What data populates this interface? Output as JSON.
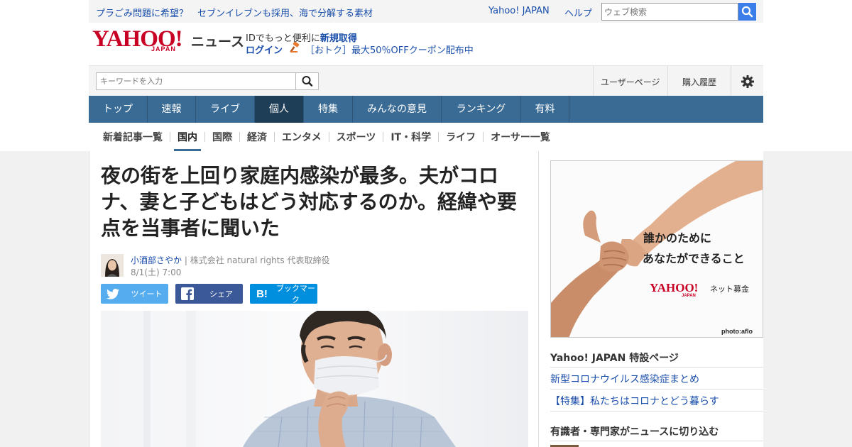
{
  "topbar": {
    "promo_1": "プラごみ問題に希望？",
    "promo_2": "セブンイレブンも採用、海で分解する素材",
    "yahoo_japan": "Yahoo! JAPAN",
    "help": "ヘルプ",
    "web_search_placeholder": "ウェブ検索"
  },
  "header": {
    "logo_yahoo": "YAHOO!",
    "logo_japan": "JAPAN",
    "logo_news": "ニュース",
    "id_text": "IDでもっと便利に",
    "signup": "新規取得",
    "login": "ログイン",
    "coupon": "［おトク］最大50％OFFクーポン配布中"
  },
  "search": {
    "placeholder": "キーワードを入力",
    "user_page": "ユーザーページ",
    "purchase_history": "購入履歴"
  },
  "main_nav": [
    {
      "label": "トップ",
      "active": false
    },
    {
      "label": "速報",
      "active": false
    },
    {
      "label": "ライブ",
      "active": false
    },
    {
      "label": "個人",
      "active": true
    },
    {
      "label": "特集",
      "active": false
    },
    {
      "label": "みんなの意見",
      "active": false
    },
    {
      "label": "ランキング",
      "active": false
    },
    {
      "label": "有料",
      "active": false
    }
  ],
  "sub_nav": [
    {
      "label": "新着記事一覧",
      "active": false
    },
    {
      "label": "国内",
      "active": true
    },
    {
      "label": "国際",
      "active": false
    },
    {
      "label": "経済",
      "active": false
    },
    {
      "label": "エンタメ",
      "active": false
    },
    {
      "label": "スポーツ",
      "active": false
    },
    {
      "label": "IT・科学",
      "active": false
    },
    {
      "label": "ライフ",
      "active": false
    },
    {
      "label": "オーサー一覧",
      "active": false
    }
  ],
  "article": {
    "title": "夜の街を上回り家庭内感染が最多。夫がコロナ、妻と子どもはどう対応するのか。経緯や要点を当事者に聞いた",
    "author": "小酒部さやか",
    "affiliation": "| 株式会社 natural rights 代表取締役",
    "date": "8/1(土) 7:00",
    "share_tweet": "ツイート",
    "share_facebook": "シェア",
    "share_bookmark": "ブックマーク"
  },
  "sidebar": {
    "ad_line1": "誰かのために",
    "ad_line2": "あなたができること",
    "ad_logo": "YAHOO!",
    "ad_logo_sub": "JAPAN",
    "ad_service": "ネット募金",
    "ad_credit": "photo:aflo",
    "special_heading": "Yahoo! JAPAN 特設ページ",
    "special_link_1": "新型コロナウイルス感染症まとめ",
    "special_link_2": "【特集】私たちはコロナとどう暮らす",
    "experts_heading": "有識者・専門家がニュースに切り込む"
  }
}
